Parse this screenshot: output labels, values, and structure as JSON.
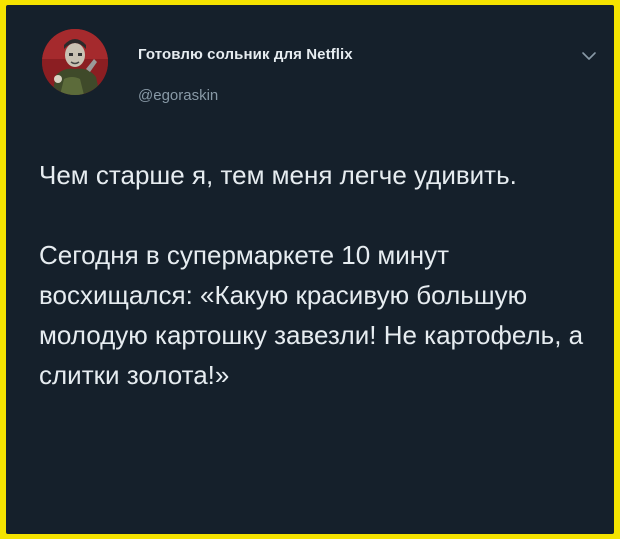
{
  "tweet": {
    "display_name": "Готовлю сольник для Netflix",
    "handle": "@egoraskin",
    "paragraphs": [
      "Чем старше я, тем меня легче удивить.",
      "Сегодня в супермаркете 10 минут восхищался: «Какую красивую большую молодую картошку завезли! Не картофель, а слитки золота!»"
    ]
  },
  "icons": {
    "avatar": "avatar-photo",
    "menu": "chevron-down-icon"
  },
  "colors": {
    "frame": "#f5e300",
    "background": "#15202b",
    "text": "#e6ecf0",
    "secondary_text": "#8899a6"
  }
}
